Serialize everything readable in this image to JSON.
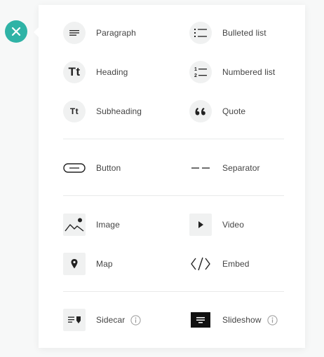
{
  "close_button": {
    "icon": "close-icon",
    "color": "#2fb3a6"
  },
  "blocks": {
    "paragraph": {
      "label": "Paragraph",
      "icon": "paragraph-icon"
    },
    "bulleted_list": {
      "label": "Bulleted list",
      "icon": "bulleted-list-icon"
    },
    "heading": {
      "label": "Heading",
      "icon": "heading-icon",
      "glyph": "Tt"
    },
    "numbered_list": {
      "label": "Numbered list",
      "icon": "numbered-list-icon"
    },
    "subheading": {
      "label": "Subheading",
      "icon": "subheading-icon",
      "glyph": "Tt"
    },
    "quote": {
      "label": "Quote",
      "icon": "quote-icon"
    },
    "button": {
      "label": "Button",
      "icon": "button-icon"
    },
    "separator": {
      "label": "Separator",
      "icon": "separator-icon"
    },
    "image": {
      "label": "Image",
      "icon": "image-icon"
    },
    "video": {
      "label": "Video",
      "icon": "video-icon"
    },
    "map": {
      "label": "Map",
      "icon": "map-pin-icon"
    },
    "embed": {
      "label": "Embed",
      "icon": "embed-code-icon"
    },
    "sidecar": {
      "label": "Sidecar",
      "icon": "sidecar-icon",
      "info_icon": "info-icon"
    },
    "slideshow": {
      "label": "Slideshow",
      "icon": "slideshow-icon",
      "info_icon": "info-icon"
    }
  }
}
